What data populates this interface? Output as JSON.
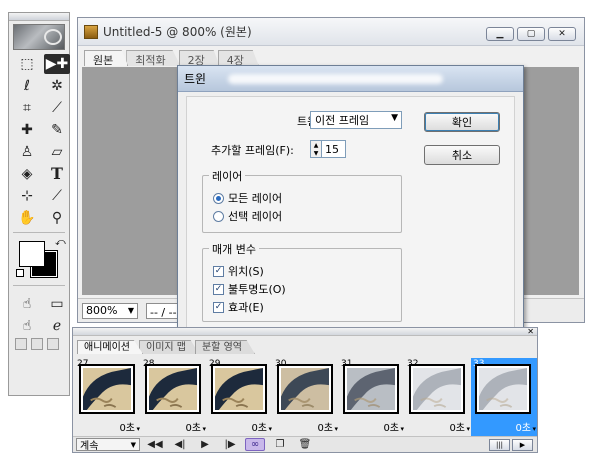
{
  "toolbox": {
    "tools": [
      {
        "name": "rect-marquee-icon",
        "glyph": "⬚"
      },
      {
        "name": "move-tool-icon",
        "glyph": "▶✚",
        "selected": true
      },
      {
        "name": "lasso-icon",
        "glyph": "ℓ"
      },
      {
        "name": "magic-wand-icon",
        "glyph": "✲"
      },
      {
        "name": "crop-slice-icon",
        "glyph": "⌗"
      },
      {
        "name": "slice-select-icon",
        "glyph": "⟋"
      },
      {
        "name": "healing-brush-icon",
        "glyph": "✚"
      },
      {
        "name": "brush-icon",
        "glyph": "✎"
      },
      {
        "name": "clone-stamp-icon",
        "glyph": "♙"
      },
      {
        "name": "eraser-icon",
        "glyph": "▱"
      },
      {
        "name": "paint-bucket-icon",
        "glyph": "◈"
      },
      {
        "name": "type-tool-icon",
        "glyph": "T"
      },
      {
        "name": "crop-icon",
        "glyph": "⊹"
      },
      {
        "name": "eyedropper-icon",
        "glyph": "⟋"
      },
      {
        "name": "hand-icon",
        "glyph": "✋"
      },
      {
        "name": "zoom-icon",
        "glyph": "⚲"
      }
    ],
    "bottom_tools": [
      {
        "name": "rollover-icon",
        "glyph": "☝"
      },
      {
        "name": "image-map-icon",
        "glyph": "▭"
      },
      {
        "name": "jump-to-imageready-icon",
        "glyph": "☝"
      },
      {
        "name": "browser-preview-icon",
        "glyph": "ℯ"
      }
    ]
  },
  "document": {
    "title": "Untitled-5 @ 800% (원본)",
    "tabs": [
      "원본",
      "최적화",
      "2장",
      "4장"
    ],
    "zoom": "800%",
    "status": "-- / --초"
  },
  "dialog": {
    "title": "트윈",
    "tween_label": "트윈(T):",
    "tween_value": "이전 프레임",
    "frames_label": "추가할 프레임(F):",
    "frames_value": "15",
    "ok": "확인",
    "cancel": "취소",
    "layers_group": "레이어",
    "layer_options": [
      {
        "label": "모든 레이어",
        "checked": true
      },
      {
        "label": "선택 레이어",
        "checked": false
      }
    ],
    "params_group": "매개 변수",
    "params": [
      {
        "label": "위치(S)",
        "checked": true
      },
      {
        "label": "불투명도(O)",
        "checked": true
      },
      {
        "label": "효과(E)",
        "checked": true
      }
    ]
  },
  "animation": {
    "tabs": [
      "애니메이션",
      "이미지 맵",
      "분할 영역"
    ],
    "frames": [
      {
        "num": "27",
        "delay": "0초",
        "style": "dark"
      },
      {
        "num": "28",
        "delay": "0초",
        "style": "dark"
      },
      {
        "num": "29",
        "delay": "0초",
        "style": "dark"
      },
      {
        "num": "30",
        "delay": "0초",
        "style": "mid"
      },
      {
        "num": "31",
        "delay": "0초",
        "style": "dim"
      },
      {
        "num": "32",
        "delay": "0초",
        "style": "faint"
      },
      {
        "num": "33",
        "delay": "0초",
        "style": "faint",
        "selected": true
      }
    ],
    "loop": "계속",
    "selected_color": "#3399ff"
  }
}
